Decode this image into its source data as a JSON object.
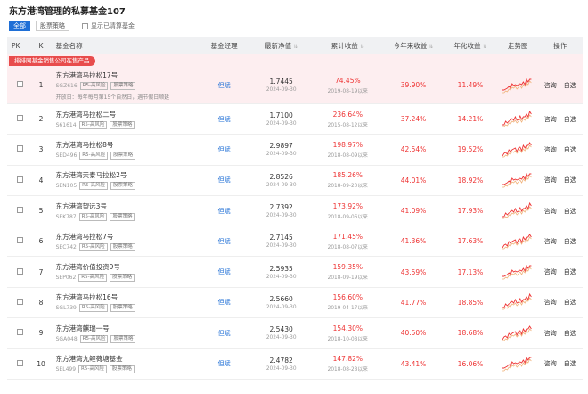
{
  "title": "东方港湾管理的私募基金107",
  "filters": {
    "all": "全部",
    "strategy": "股票策略",
    "show_liquidated": "显示已清算基金"
  },
  "columns": {
    "pk": "PK",
    "k": "K",
    "name": "基金名称",
    "manager": "基金经理",
    "nav": "最新净值",
    "cumulative": "累计收益",
    "ytd": "今年来收益",
    "annual": "年化收益",
    "trend": "走势图",
    "ops": "操作"
  },
  "banner": "排排网基金销售公司在售产品",
  "op_labels": {
    "consult": "咨询",
    "watch": "自选"
  },
  "rows": [
    {
      "k": "1",
      "name": "东方港湾马拉松17号",
      "code": "SGZ616",
      "risk": "R5-高风险",
      "strategy": "股票策略",
      "manager": "但斌",
      "nav": "1.7445",
      "nav_date": "2024-09-30",
      "cum": "74.45%",
      "since": "2019-08-19以来",
      "ytd": "39.90%",
      "annual": "11.49%",
      "note": "开放日：每年每月第15个自然日，遇节假日顺延"
    },
    {
      "k": "2",
      "name": "东方港湾马拉松二号",
      "code": "S61614",
      "risk": "R5-高风险",
      "strategy": "股票策略",
      "manager": "但斌",
      "nav": "1.7100",
      "nav_date": "2024-09-30",
      "cum": "236.64%",
      "since": "2015-08-12以来",
      "ytd": "37.24%",
      "annual": "14.21%"
    },
    {
      "k": "3",
      "name": "东方港湾马拉松8号",
      "code": "SED496",
      "risk": "R5-高风险",
      "strategy": "股票策略",
      "manager": "但斌",
      "nav": "2.9897",
      "nav_date": "2024-09-30",
      "cum": "198.97%",
      "since": "2018-08-09以来",
      "ytd": "42.54%",
      "annual": "19.52%"
    },
    {
      "k": "4",
      "name": "东方港湾天泰马拉松2号",
      "code": "SEN105",
      "risk": "R5-高风险",
      "strategy": "股票策略",
      "manager": "但斌",
      "nav": "2.8526",
      "nav_date": "2024-09-30",
      "cum": "185.26%",
      "since": "2018-09-20以来",
      "ytd": "44.01%",
      "annual": "18.92%"
    },
    {
      "k": "5",
      "name": "东方港湾望远3号",
      "code": "SEK787",
      "risk": "R5-高风险",
      "strategy": "股票策略",
      "manager": "但斌",
      "nav": "2.7392",
      "nav_date": "2024-09-30",
      "cum": "173.92%",
      "since": "2018-09-06以来",
      "ytd": "41.09%",
      "annual": "17.93%"
    },
    {
      "k": "6",
      "name": "东方港湾马拉松7号",
      "code": "SEC742",
      "risk": "R5-高风险",
      "strategy": "股票策略",
      "manager": "但斌",
      "nav": "2.7145",
      "nav_date": "2024-09-30",
      "cum": "171.45%",
      "since": "2018-08-07以来",
      "ytd": "41.36%",
      "annual": "17.63%"
    },
    {
      "k": "7",
      "name": "东方港湾价值投资9号",
      "code": "SEP062",
      "risk": "R5-高风险",
      "strategy": "股票策略",
      "manager": "但斌",
      "nav": "2.5935",
      "nav_date": "2024-09-30",
      "cum": "159.35%",
      "since": "2018-09-19以来",
      "ytd": "43.59%",
      "annual": "17.13%"
    },
    {
      "k": "8",
      "name": "东方港湾马拉松16号",
      "code": "SGL739",
      "risk": "R5-高风险",
      "strategy": "股票策略",
      "manager": "但斌",
      "nav": "2.5660",
      "nav_date": "2024-09-30",
      "cum": "156.60%",
      "since": "2019-04-17以来",
      "ytd": "41.77%",
      "annual": "18.85%"
    },
    {
      "k": "9",
      "name": "东方港湾麒瑞一号",
      "code": "SGA048",
      "risk": "R5-高风险",
      "strategy": "股票策略",
      "manager": "但斌",
      "nav": "2.5430",
      "nav_date": "2024-09-30",
      "cum": "154.30%",
      "since": "2018-10-08以来",
      "ytd": "40.50%",
      "annual": "18.68%"
    },
    {
      "k": "10",
      "name": "东方港湾九鲤荷塘基金",
      "code": "SEL499",
      "risk": "R5-高风险",
      "strategy": "股票策略",
      "manager": "但斌",
      "nav": "2.4782",
      "nav_date": "2024-09-30",
      "cum": "147.82%",
      "since": "2018-08-28以来",
      "ytd": "43.41%",
      "annual": "16.06%"
    }
  ],
  "colors": {
    "accent": "#1f6fd6",
    "positive": "#e33333",
    "banner": "#e84c4c",
    "highlight_bg": "#fdeef0"
  }
}
